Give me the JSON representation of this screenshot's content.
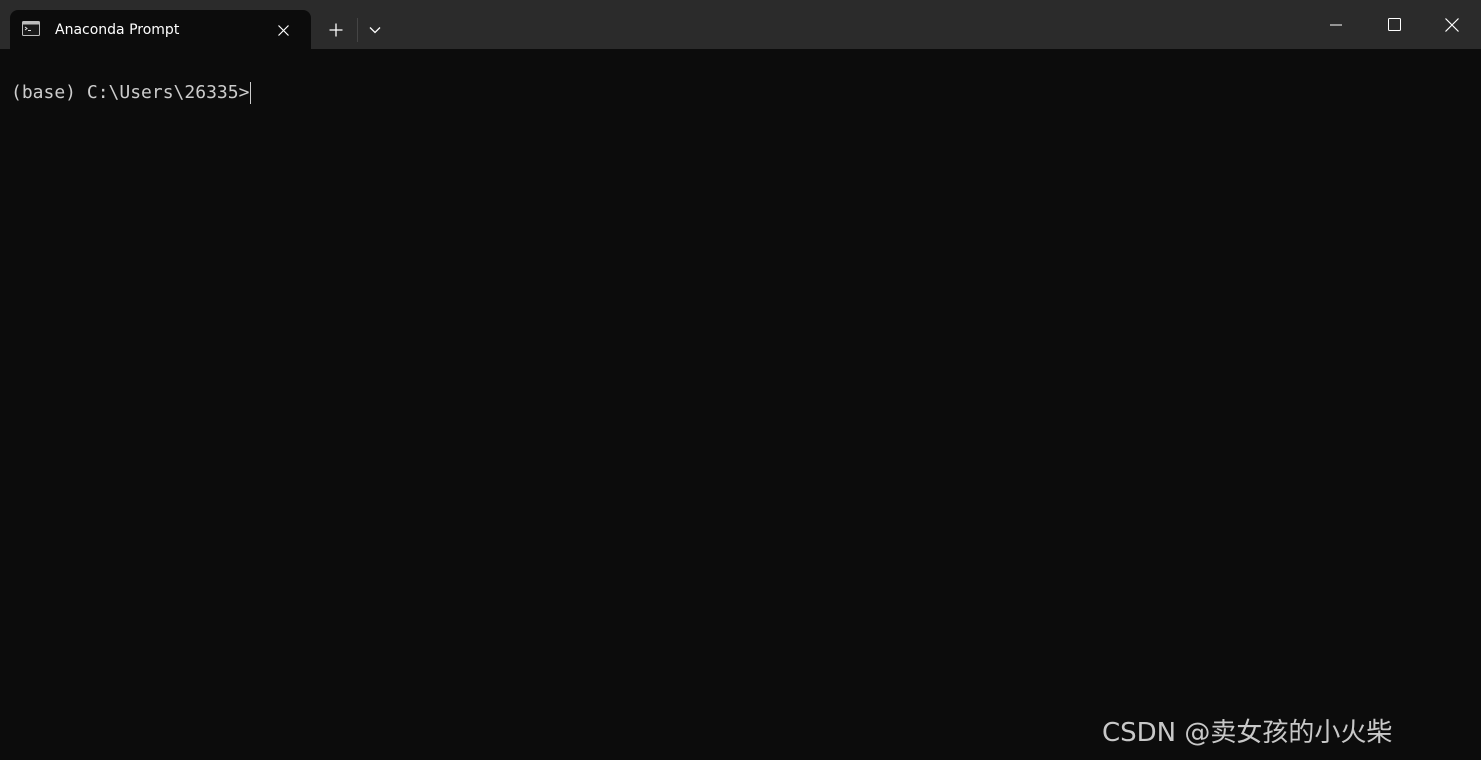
{
  "tab": {
    "title": "Anaconda Prompt",
    "icon": "terminal-icon"
  },
  "tab_actions": {
    "new_tab_icon": "plus-icon",
    "dropdown_icon": "chevron-down-icon"
  },
  "window_controls": {
    "minimize_icon": "minimize-icon",
    "maximize_icon": "maximize-icon",
    "close_icon": "close-icon"
  },
  "terminal": {
    "prompt": "(base) C:\\Users\\26335>"
  },
  "watermark": {
    "text": "CSDN @卖女孩的小火柴"
  },
  "colors": {
    "titlebar": "#2b2b2b",
    "terminal_bg": "#0c0c0c",
    "terminal_text": "#cccccc"
  }
}
